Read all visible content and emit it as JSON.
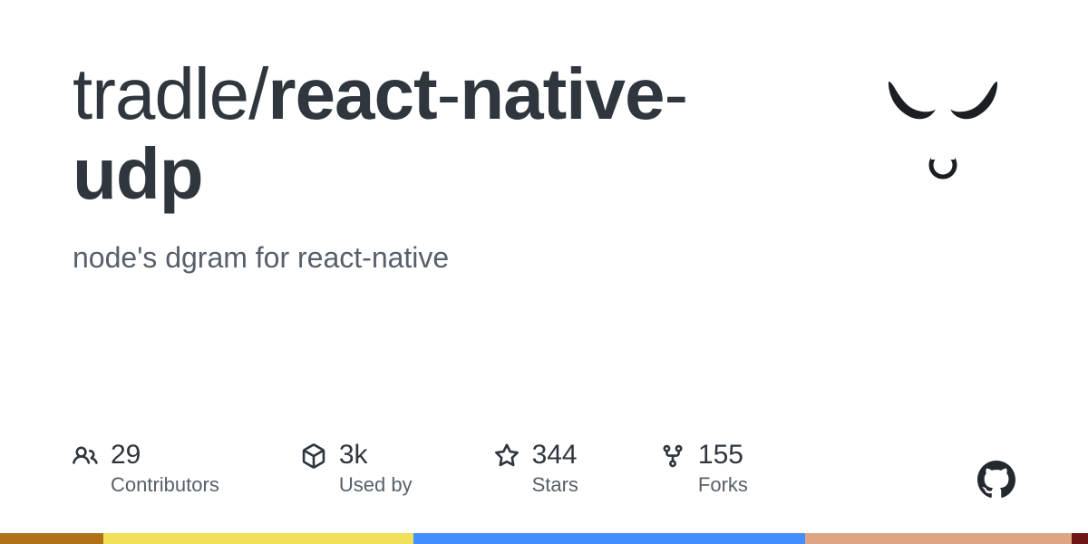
{
  "repo": {
    "owner": "tradle",
    "slash": "/",
    "name_part1": "react",
    "hyphen1": "-",
    "name_part2": "native",
    "hyphen2": "-",
    "name_part3": "udp"
  },
  "description": "node's dgram for react-native",
  "stats": {
    "contributors": {
      "value": "29",
      "label": "Contributors"
    },
    "usedby": {
      "value": "3k",
      "label": "Used by"
    },
    "stars": {
      "value": "344",
      "label": "Stars"
    },
    "forks": {
      "value": "155",
      "label": "Forks"
    }
  },
  "lang_colors": {
    "a": {
      "color": "#b07219",
      "width": "9.5%"
    },
    "b": {
      "color": "#f1e05a",
      "width": "28.5%"
    },
    "c": {
      "color": "#438eff",
      "width": "36%"
    },
    "d": {
      "color": "#DEA584",
      "width": "24.5%"
    },
    "e": {
      "color": "#701516",
      "width": "1.5%"
    }
  }
}
